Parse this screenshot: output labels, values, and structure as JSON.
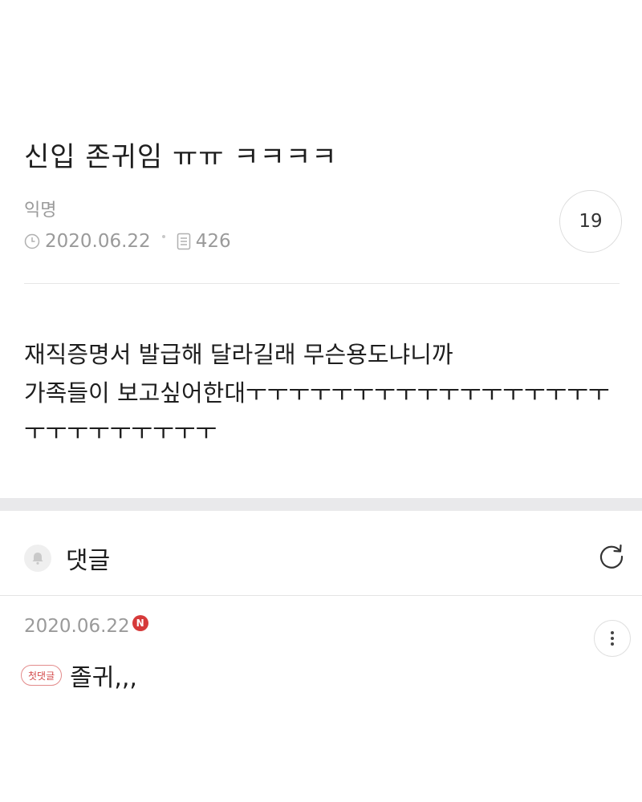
{
  "post": {
    "title": "신입 존귀임 ㅠㅠ ㅋㅋㅋㅋ",
    "author": "익명",
    "date": "2020.06.22",
    "views": "426",
    "comment_count": "19",
    "body_lines": [
      "재직증명서 발급해 달라길래 무슨용도냐니까",
      "가족들이 보고싶어한대ㅜㅜㅜㅜㅜㅜㅜㅜㅜㅜㅜㅜㅜㅜㅜㅜㅜ",
      "ㅜㅜㅜㅜㅜㅜㅜㅜㅜ"
    ]
  },
  "comments_section": {
    "title": "댓글",
    "comments": [
      {
        "date": "2020.06.22",
        "new_badge": "N",
        "tag": "첫댓글",
        "text": "졸귀,,,"
      }
    ]
  },
  "icons": {
    "clock": "clock-icon",
    "views": "document-icon",
    "bell": "bell-icon",
    "refresh": "refresh-icon",
    "more": "more-vertical-icon"
  },
  "colors": {
    "accent_red": "#d63a3a",
    "muted_text": "#9a9a9a",
    "band": "#e9e9eb"
  }
}
